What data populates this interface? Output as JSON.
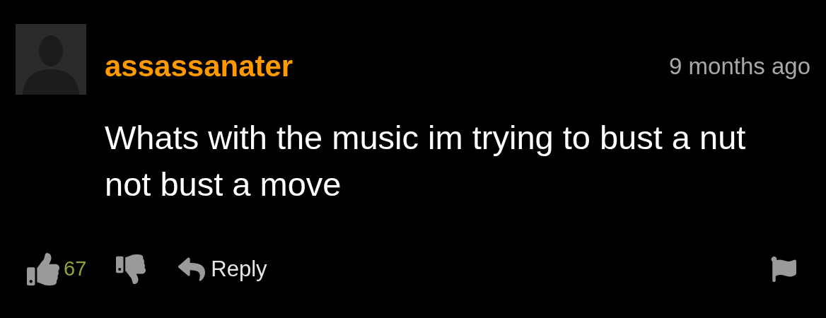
{
  "comment": {
    "author": "assassanater",
    "time": "9 months ago",
    "text": "Whats with the music im trying to bust a nut not bust a move",
    "likes": "67",
    "reply_label": "Reply"
  }
}
